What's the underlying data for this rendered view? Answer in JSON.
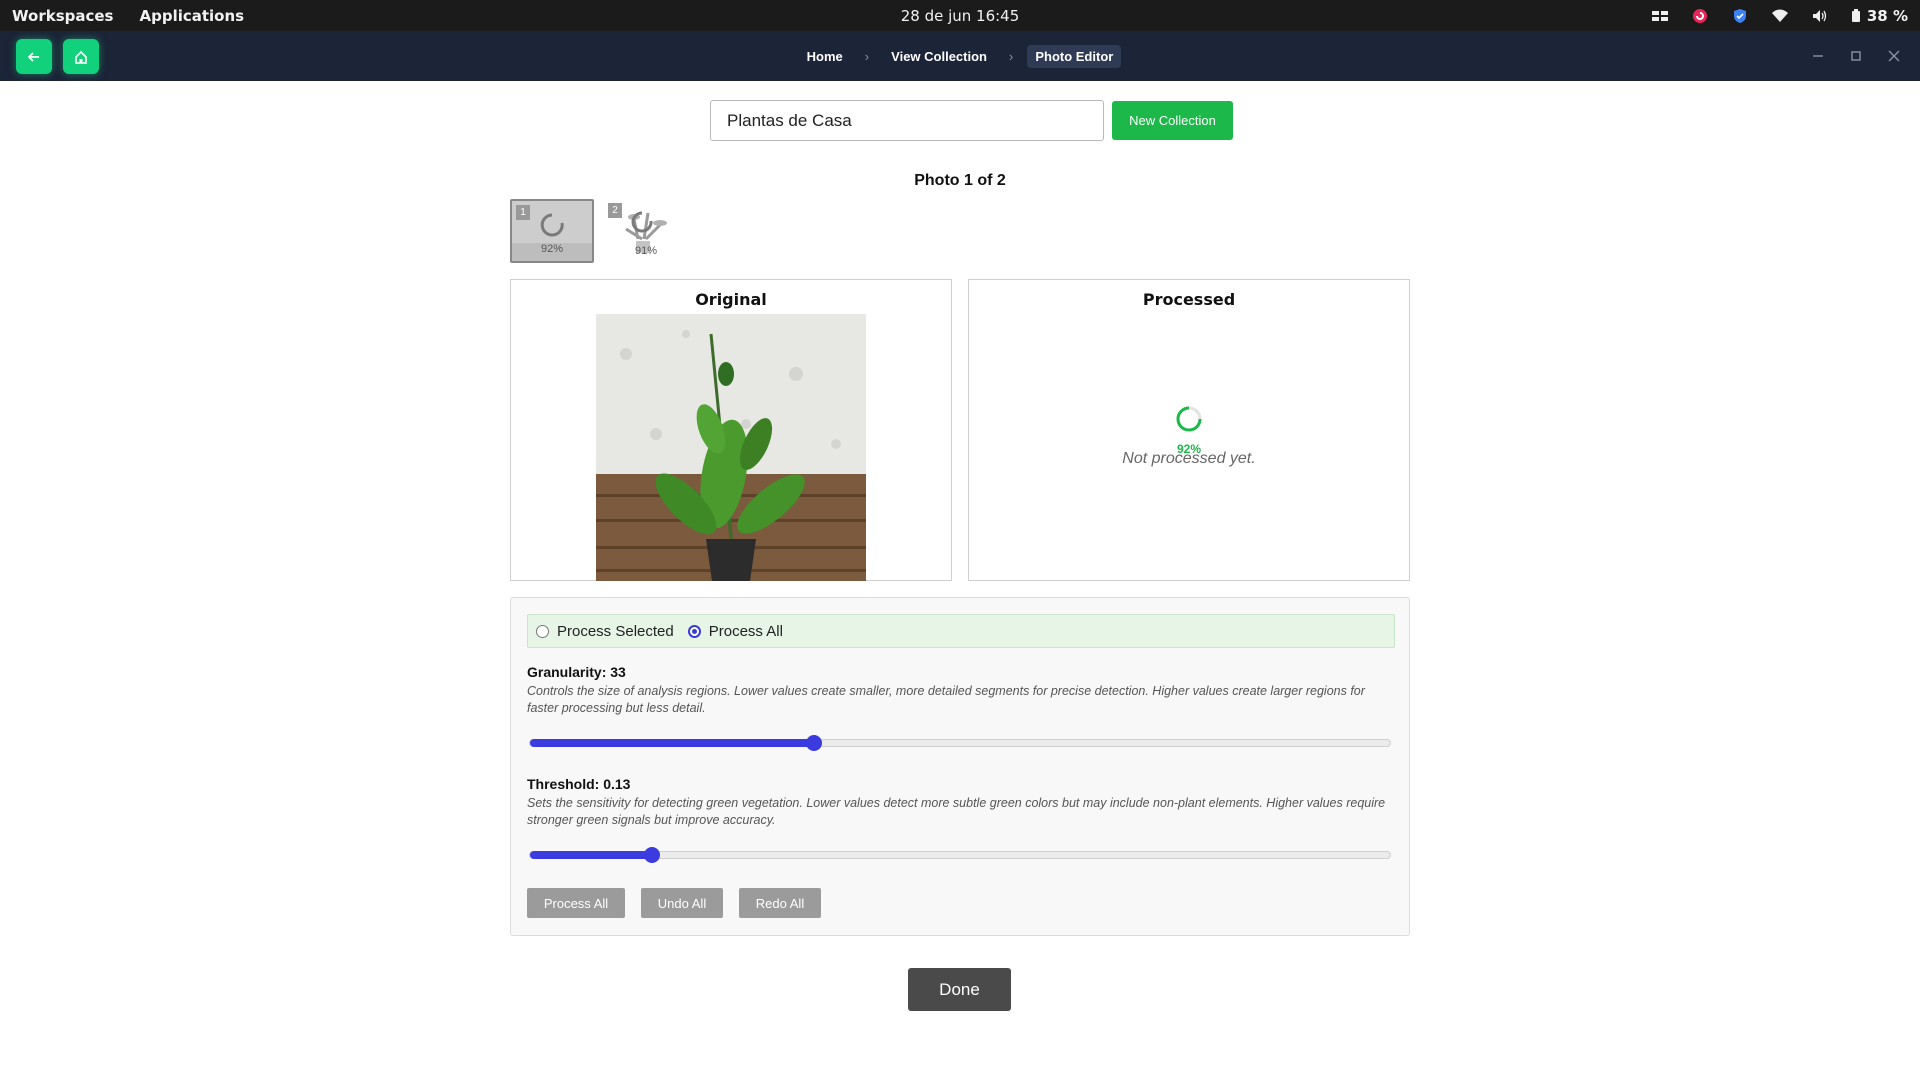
{
  "system_bar": {
    "workspaces": "Workspaces",
    "applications": "Applications",
    "clock": "28 de jun  16:45",
    "battery": "38 %"
  },
  "header": {
    "breadcrumbs": [
      "Home",
      "View Collection",
      "Photo Editor"
    ],
    "breadcrumb_separator": "›",
    "accent_color": "#12d17c"
  },
  "collection": {
    "name_value": "Plantas de Casa",
    "new_button": "New Collection"
  },
  "photo_counter": "Photo 1 of 2",
  "thumbnails": [
    {
      "index": "1",
      "percent": "92%",
      "selected": true
    },
    {
      "index": "2",
      "percent": "91%",
      "selected": false
    }
  ],
  "panels": {
    "original_title": "Original",
    "processed_title": "Processed",
    "processing_percent": "92%",
    "not_processed": "Not processed yet."
  },
  "mode": {
    "options": [
      "Process Selected",
      "Process All"
    ],
    "selected": "Process All"
  },
  "granularity": {
    "label": "Granularity: 33",
    "value": 33,
    "fill_fraction": 0.33,
    "description": "Controls the size of analysis regions. Lower values create smaller, more detailed segments for precise detection. Higher values create larger regions for faster processing but less detail."
  },
  "threshold": {
    "label": "Threshold: 0.13",
    "value": 0.13,
    "fill_fraction": 0.142,
    "description": "Sets the sensitivity for detecting green vegetation. Lower values detect more subtle green colors but may include non-plant elements. Higher values require stronger green signals but improve accuracy."
  },
  "actions": {
    "process_all": "Process All",
    "undo_all": "Undo All",
    "redo_all": "Redo All",
    "done": "Done"
  },
  "colors": {
    "slider": "#3b3be0",
    "green_button": "#1cb84a",
    "header_bg": "#1c2438"
  }
}
